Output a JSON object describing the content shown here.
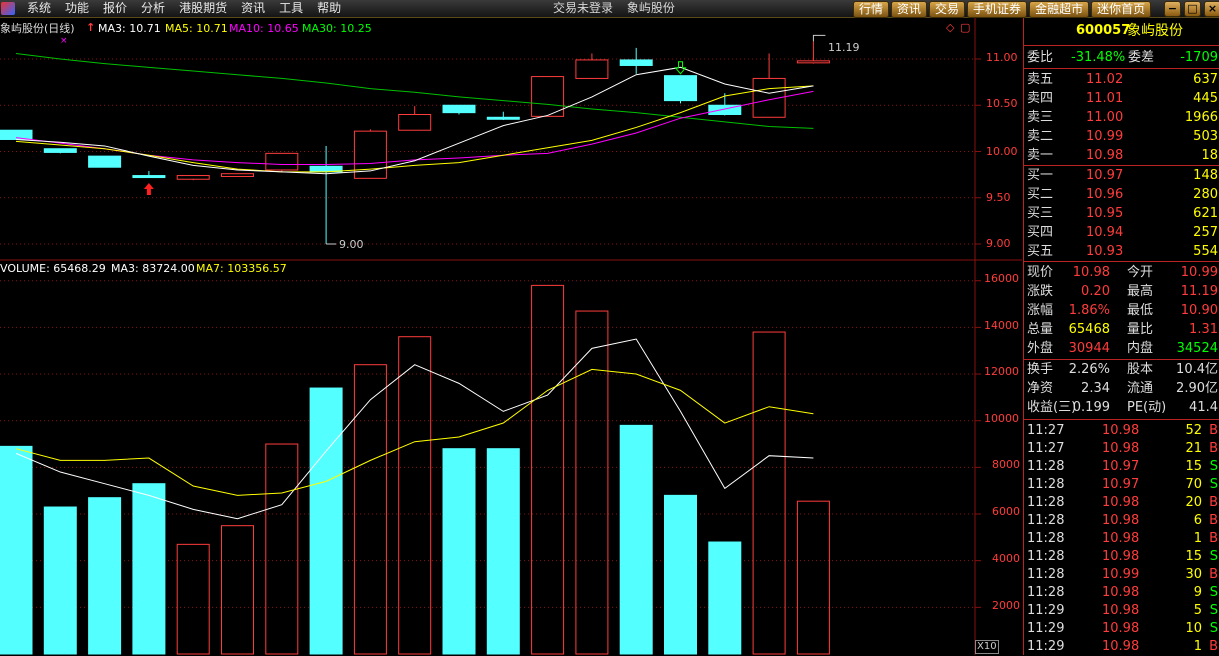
{
  "menubar": {
    "items": [
      "系统",
      "功能",
      "报价",
      "分析",
      "港股期货",
      "资讯",
      "工具",
      "帮助"
    ],
    "login_status": "交易未登录",
    "stock_title": "象屿股份"
  },
  "toolbar": {
    "buttons": [
      "行情",
      "资讯",
      "交易",
      "手机证券",
      "金融超市",
      "迷你首页"
    ]
  },
  "price_panel": {
    "title": "象屿股份(日线)",
    "ma3": "MA3: 10.71",
    "ma5": "MA5: 10.71",
    "ma10": "MA10: 10.65",
    "ma30": "MA30: 10.25",
    "high_label": "11.19",
    "low_label": "9.00",
    "y_ticks": [
      "11.00",
      "10.50",
      "10.00",
      "9.50",
      "9.00"
    ]
  },
  "volume_panel": {
    "volume": "VOLUME: 65468.29",
    "ma3": "MA3: 83724.00",
    "ma7": "MA7: 103356.57",
    "y_ticks": [
      "16000",
      "14000",
      "12000",
      "10000",
      "8000",
      "6000",
      "4000",
      "2000"
    ],
    "unit": "X10"
  },
  "colors": {
    "up": "#ff3c3c",
    "down": "#54ffff",
    "ma5": "#ffffff",
    "ma10": "#ffff00",
    "ma30": "#ff00ff",
    "ma60": "#00c000",
    "grid": "#8a1010",
    "label_green": "#00ff00",
    "label_red": "#ff3c3c",
    "label_yellow": "#ffff00"
  },
  "chart_data": {
    "type": "candlestick",
    "candles": [
      {
        "open": 10.23,
        "close": 10.13,
        "high": 10.23,
        "low": 10.13
      },
      {
        "open": 10.03,
        "close": 9.99,
        "high": 10.03,
        "low": 9.98
      },
      {
        "open": 9.95,
        "close": 9.83,
        "high": 9.95,
        "low": 9.83
      },
      {
        "open": 9.74,
        "close": 9.72,
        "high": 9.79,
        "low": 9.72
      },
      {
        "open": 9.7,
        "close": 9.74,
        "high": 9.74,
        "low": 9.69
      },
      {
        "open": 9.73,
        "close": 9.76,
        "high": 9.76,
        "low": 9.73
      },
      {
        "open": 9.8,
        "close": 9.98,
        "high": 9.98,
        "low": 9.78
      },
      {
        "open": 9.84,
        "close": 9.78,
        "high": 10.06,
        "low": 9.0
      },
      {
        "open": 9.71,
        "close": 10.22,
        "high": 10.24,
        "low": 9.71
      },
      {
        "open": 10.23,
        "close": 10.4,
        "high": 10.49,
        "low": 10.23
      },
      {
        "open": 10.5,
        "close": 10.42,
        "high": 10.5,
        "low": 10.4
      },
      {
        "open": 10.37,
        "close": 10.35,
        "high": 10.43,
        "low": 10.34
      },
      {
        "open": 10.38,
        "close": 10.81,
        "high": 10.81,
        "low": 10.38
      },
      {
        "open": 10.79,
        "close": 10.99,
        "high": 11.06,
        "low": 10.79
      },
      {
        "open": 10.99,
        "close": 10.93,
        "high": 11.12,
        "low": 10.84
      },
      {
        "open": 10.82,
        "close": 10.55,
        "high": 10.82,
        "low": 10.52
      },
      {
        "open": 10.5,
        "close": 10.4,
        "high": 10.63,
        "low": 10.39
      },
      {
        "open": 10.37,
        "close": 10.79,
        "high": 11.06,
        "low": 10.37
      },
      {
        "open": 10.98,
        "close": 10.98,
        "high": 11.19,
        "low": 10.95
      }
    ],
    "ma5": [
      10.13,
      10.1,
      10.06,
      9.95,
      9.85,
      9.8,
      9.78,
      9.76,
      9.79,
      9.9,
      10.09,
      10.28,
      10.39,
      10.59,
      10.83,
      10.91,
      10.73,
      10.63,
      10.71
    ],
    "ma10": [
      10.11,
      10.07,
      10.03,
      9.96,
      9.88,
      9.81,
      9.78,
      9.78,
      9.81,
      9.85,
      9.88,
      9.96,
      10.04,
      10.12,
      10.26,
      10.42,
      10.6,
      10.68,
      10.71
    ],
    "ma30": [
      10.15,
      10.09,
      10.03,
      9.96,
      9.91,
      9.88,
      9.86,
      9.86,
      9.87,
      9.91,
      9.93,
      9.96,
      9.98,
      10.08,
      10.2,
      10.36,
      10.46,
      10.56,
      10.65
    ],
    "ma60": [
      11.06,
      11.0,
      10.95,
      10.91,
      10.87,
      10.83,
      10.79,
      10.74,
      10.68,
      10.64,
      10.59,
      10.55,
      10.51,
      10.46,
      10.42,
      10.37,
      10.32,
      10.27,
      10.25
    ],
    "volumes": [
      8900,
      6300,
      6700,
      7300,
      4700,
      5500,
      9000,
      11400,
      12400,
      13600,
      8800,
      8800,
      15800,
      14700,
      9800,
      6800,
      4800,
      13800,
      6550
    ],
    "vol_ma3": [
      8600,
      7800,
      7300,
      6800,
      6200,
      5800,
      6400,
      8700,
      10900,
      12400,
      11600,
      10400,
      11100,
      13100,
      13500,
      10400,
      7100,
      8500,
      8400
    ],
    "vol_ma7": [
      8800,
      8300,
      8300,
      8400,
      7200,
      6800,
      6900,
      7400,
      8300,
      9100,
      9300,
      9900,
      11300,
      12200,
      12000,
      11300,
      9900,
      10600,
      10300
    ]
  },
  "right_panel": {
    "code": "600057",
    "name": "象屿股份",
    "weibi": {
      "label": "委比",
      "value": "-31.48%",
      "diff_label": "委差",
      "diff_value": "-1709"
    },
    "asks": [
      {
        "label": "卖五",
        "price": "11.02",
        "vol": "637"
      },
      {
        "label": "卖四",
        "price": "11.01",
        "vol": "445"
      },
      {
        "label": "卖三",
        "price": "11.00",
        "vol": "1966"
      },
      {
        "label": "卖二",
        "price": "10.99",
        "vol": "503"
      },
      {
        "label": "卖一",
        "price": "10.98",
        "vol": "18"
      }
    ],
    "bids": [
      {
        "label": "买一",
        "price": "10.97",
        "vol": "148"
      },
      {
        "label": "买二",
        "price": "10.96",
        "vol": "280"
      },
      {
        "label": "买三",
        "price": "10.95",
        "vol": "621"
      },
      {
        "label": "买四",
        "price": "10.94",
        "vol": "257"
      },
      {
        "label": "买五",
        "price": "10.93",
        "vol": "554"
      }
    ],
    "stats": [
      {
        "l1": "现价",
        "v1": "10.98",
        "c1": "#ff3c3c",
        "l2": "今开",
        "v2": "10.99",
        "c2": "#ff3c3c"
      },
      {
        "l1": "涨跌",
        "v1": "0.20",
        "c1": "#ff3c3c",
        "l2": "最高",
        "v2": "11.19",
        "c2": "#ff3c3c"
      },
      {
        "l1": "涨幅",
        "v1": "1.86%",
        "c1": "#ff3c3c",
        "l2": "最低",
        "v2": "10.90",
        "c2": "#ff3c3c"
      },
      {
        "l1": "总量",
        "v1": "65468",
        "c1": "#ffff00",
        "l2": "量比",
        "v2": "1.31",
        "c2": "#ff3c3c"
      },
      {
        "l1": "外盘",
        "v1": "30944",
        "c1": "#ff3c3c",
        "l2": "内盘",
        "v2": "34524",
        "c2": "#00ff00"
      }
    ],
    "stats2": [
      {
        "l1": "换手",
        "v1": "2.26%",
        "l2": "股本",
        "v2": "10.4亿"
      },
      {
        "l1": "净资",
        "v1": "2.34",
        "l2": "流通",
        "v2": "2.90亿"
      },
      {
        "l1": "收益(三)",
        "v1": "0.199",
        "l2": "PE(动)",
        "v2": "41.4"
      }
    ],
    "trades": [
      {
        "time": "11:27",
        "price": "10.98",
        "vol": "52",
        "side": "B"
      },
      {
        "time": "11:27",
        "price": "10.98",
        "vol": "21",
        "side": "B"
      },
      {
        "time": "11:28",
        "price": "10.97",
        "vol": "15",
        "side": "S"
      },
      {
        "time": "11:28",
        "price": "10.97",
        "vol": "70",
        "side": "S"
      },
      {
        "time": "11:28",
        "price": "10.98",
        "vol": "20",
        "side": "B"
      },
      {
        "time": "11:28",
        "price": "10.98",
        "vol": "6",
        "side": "B"
      },
      {
        "time": "11:28",
        "price": "10.98",
        "vol": "1",
        "side": "B"
      },
      {
        "time": "11:28",
        "price": "10.98",
        "vol": "15",
        "side": "S"
      },
      {
        "time": "11:28",
        "price": "10.99",
        "vol": "30",
        "side": "B"
      },
      {
        "time": "11:28",
        "price": "10.98",
        "vol": "9",
        "side": "S"
      },
      {
        "time": "11:29",
        "price": "10.98",
        "vol": "5",
        "side": "S"
      },
      {
        "time": "11:29",
        "price": "10.98",
        "vol": "10",
        "side": "S"
      },
      {
        "time": "11:29",
        "price": "10.98",
        "vol": "1",
        "side": "B"
      }
    ]
  }
}
